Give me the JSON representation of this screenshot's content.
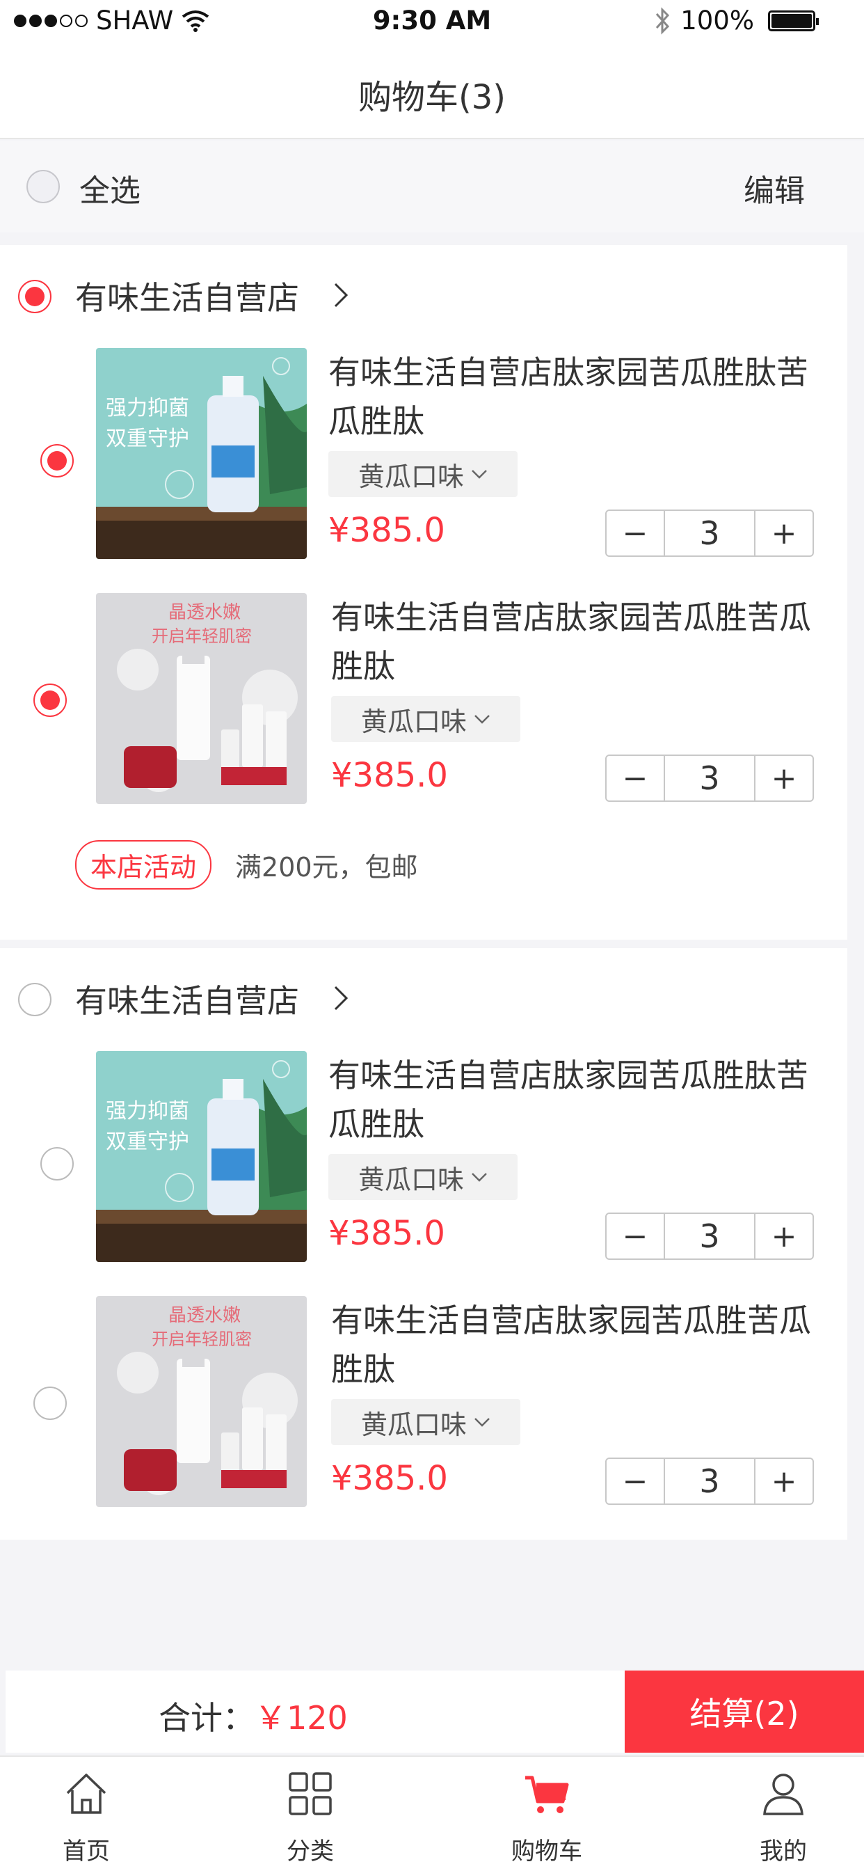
{
  "status": {
    "carrier": "SHAW",
    "time": "9:30 AM",
    "battery": "100%"
  },
  "header": {
    "title": "购物车(3)"
  },
  "select_bar": {
    "select_all": "全选",
    "edit": "编辑"
  },
  "stores": [
    {
      "name": "有味生活自营店",
      "selected": true,
      "items": [
        {
          "title": "有味生活自营店肽家园苦瓜胜肽苦瓜胜肽",
          "spec": "黄瓜口味",
          "price": "¥385.0",
          "qty": "3",
          "selected": true,
          "image": "强力抑菌 双重守护"
        },
        {
          "title": "有味生活自营店肽家园苦瓜胜苦瓜胜肽",
          "spec": "黄瓜口味",
          "price": "¥385.0",
          "qty": "3",
          "selected": true,
          "image": "晶透水嫩 开启年轻肌密"
        }
      ],
      "promo": {
        "tag": "本店活动",
        "text": "满200元，包邮"
      }
    },
    {
      "name": "有味生活自营店",
      "selected": false,
      "items": [
        {
          "title": "有味生活自营店肽家园苦瓜胜肽苦瓜胜肽",
          "spec": "黄瓜口味",
          "price": "¥385.0",
          "qty": "3",
          "selected": false,
          "image": "强力抑菌 双重守护"
        },
        {
          "title": "有味生活自营店肽家园苦瓜胜苦瓜胜肽",
          "spec": "黄瓜口味",
          "price": "¥385.0",
          "qty": "3",
          "selected": false,
          "image": "晶透水嫩 开启年轻肌密"
        }
      ]
    }
  ],
  "stepper": {
    "minus": "−",
    "plus": "+"
  },
  "checkout": {
    "total_label": "合计：",
    "total_amount": "￥120",
    "button": "结算(2)"
  },
  "tabs": [
    {
      "label": "首页",
      "icon": "home-icon"
    },
    {
      "label": "分类",
      "icon": "grid-icon"
    },
    {
      "label": "购物车",
      "icon": "cart-icon"
    },
    {
      "label": "我的",
      "icon": "user-icon"
    }
  ],
  "colors": {
    "accent": "#fb3640",
    "background": "#f4f4f7"
  }
}
